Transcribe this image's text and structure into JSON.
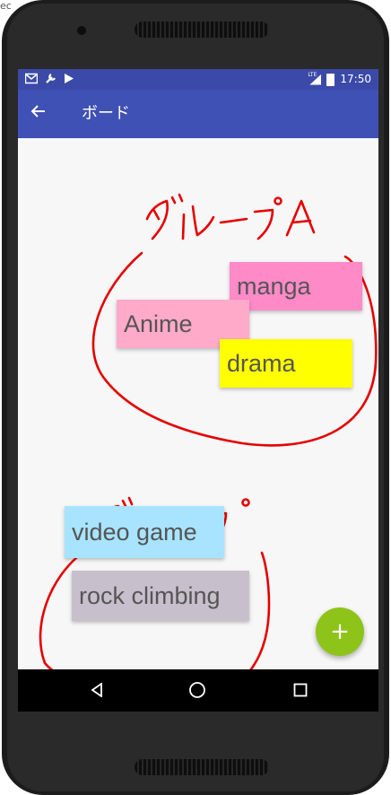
{
  "edge_fragment": "ec",
  "status_bar": {
    "left_icons": [
      "mail-icon",
      "wrench-icon",
      "play-store-icon"
    ],
    "network_label": "LTE",
    "time": "17:50"
  },
  "app_bar": {
    "title": "ボード"
  },
  "board": {
    "group_labels": [
      "グループA",
      "グループ"
    ],
    "notes": [
      {
        "text": "manga",
        "color": "#ff8ac8"
      },
      {
        "text": "Anime",
        "color": "#ffaac8"
      },
      {
        "text": "drama",
        "color": "#ffff00"
      },
      {
        "text": "video game",
        "color": "#a8e4ff"
      },
      {
        "text": "rock climbing",
        "color": "#c8bfcc"
      }
    ]
  },
  "fab": {
    "label": "+",
    "color": "#8ec41a"
  },
  "colors": {
    "status_bar": "#3b4aa8",
    "app_bar": "#3f51b5",
    "doodle": "#e60000"
  }
}
